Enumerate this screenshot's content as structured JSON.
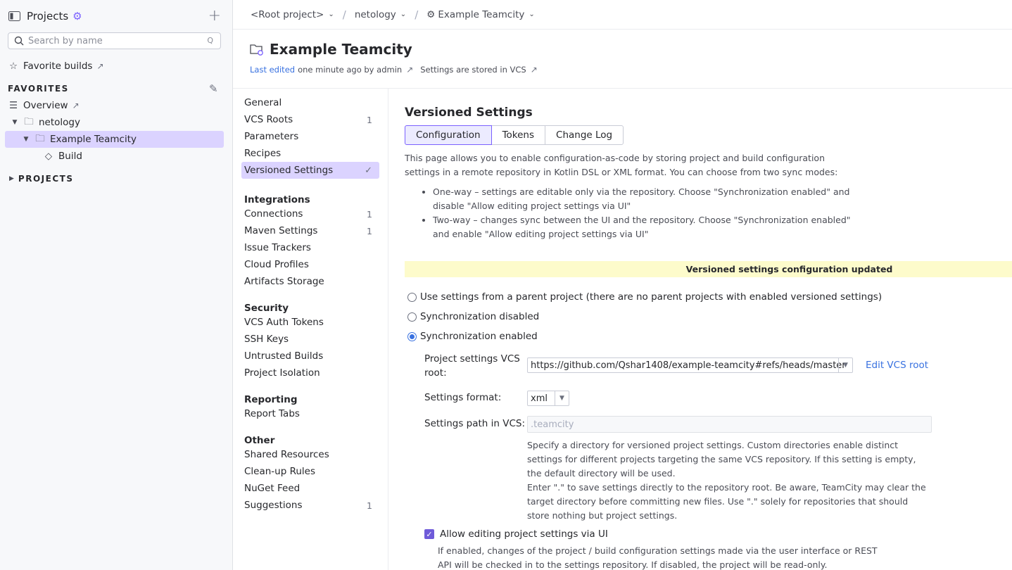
{
  "sidebar": {
    "title": "Projects",
    "search_placeholder": "Search by name",
    "search_shortcut": "Q",
    "favorite_builds": "Favorite builds",
    "favorites_heading": "FAVORITES",
    "overview": "Overview",
    "tree": [
      {
        "label": "netology"
      },
      {
        "label": "Example Teamcity"
      },
      {
        "label": "Build"
      }
    ],
    "projects_heading": "PROJECTS"
  },
  "breadcrumbs": [
    "<Root project>",
    "netology",
    "Example Teamcity"
  ],
  "header": {
    "title": "Example Teamcity",
    "last_edited_label": "Last edited",
    "last_edited_text": "one minute ago by admin",
    "settings_stored": "Settings are stored in VCS"
  },
  "nav": {
    "items": [
      {
        "label": "General",
        "badge": ""
      },
      {
        "label": "VCS Roots",
        "badge": "1"
      },
      {
        "label": "Parameters",
        "badge": ""
      },
      {
        "label": "Recipes",
        "badge": ""
      },
      {
        "label": "Versioned Settings",
        "badge": "✓"
      }
    ],
    "groups": [
      {
        "title": "Integrations",
        "items": [
          {
            "label": "Connections",
            "badge": "1"
          },
          {
            "label": "Maven Settings",
            "badge": "1"
          },
          {
            "label": "Issue Trackers",
            "badge": ""
          },
          {
            "label": "Cloud Profiles",
            "badge": ""
          },
          {
            "label": "Artifacts Storage",
            "badge": ""
          }
        ]
      },
      {
        "title": "Security",
        "items": [
          {
            "label": "VCS Auth Tokens",
            "badge": ""
          },
          {
            "label": "SSH Keys",
            "badge": ""
          },
          {
            "label": "Untrusted Builds",
            "badge": ""
          },
          {
            "label": "Project Isolation",
            "badge": ""
          }
        ]
      },
      {
        "title": "Reporting",
        "items": [
          {
            "label": "Report Tabs",
            "badge": ""
          }
        ]
      },
      {
        "title": "Other",
        "items": [
          {
            "label": "Shared Resources",
            "badge": ""
          },
          {
            "label": "Clean-up Rules",
            "badge": ""
          },
          {
            "label": "NuGet Feed",
            "badge": ""
          },
          {
            "label": "Suggestions",
            "badge": "1"
          }
        ]
      }
    ]
  },
  "content": {
    "heading": "Versioned Settings",
    "tabs": [
      "Configuration",
      "Tokens",
      "Change Log"
    ],
    "description": "This page allows you to enable configuration-as-code by storing project and build configuration settings in a remote repository in Kotlin DSL or XML format. You can choose from two sync modes:",
    "bullets": [
      "One-way – settings are editable only via the repository. Choose \"Synchronization enabled\" and disable \"Allow editing project settings via UI\"",
      "Two-way – changes sync between the UI and the repository. Choose \"Synchronization enabled\" and enable \"Allow editing project settings via UI\""
    ],
    "banner": "Versioned settings configuration updated",
    "radios": [
      {
        "label": "Use settings from a parent project (there are no parent projects with enabled versioned settings)",
        "checked": false
      },
      {
        "label": "Synchronization disabled",
        "checked": false
      },
      {
        "label": "Synchronization enabled",
        "checked": true
      }
    ],
    "vcs_root_label": "Project settings VCS root:",
    "vcs_root_value": "https://github.com/Qshar1408/example-teamcity#refs/heads/master",
    "edit_vcs_root": "Edit VCS root",
    "format_label": "Settings format:",
    "format_value": "xml",
    "path_label": "Settings path in VCS:",
    "path_placeholder": ".teamcity",
    "path_help_1": "Specify a directory for versioned project settings. Custom directories enable distinct settings for different projects targeting the same VCS repository. If this setting is empty, the default directory will be used.",
    "path_help_2": "Enter \".\" to save settings directly to the repository root. Be aware, TeamCity may clear the target directory before committing new files. Use \".\" solely for repositories that should store nothing but project settings.",
    "allow_edit_label": "Allow editing project settings via UI",
    "allow_edit_help": "If enabled, changes of the project / build configuration settings made via the user interface or REST API will be checked in to the settings repository. If disabled, the project will be read-only."
  },
  "colors": {
    "accent": "#7b61ff",
    "selection": "#dbd3ff",
    "banner": "#fdfbcb",
    "link": "#3871e0"
  }
}
